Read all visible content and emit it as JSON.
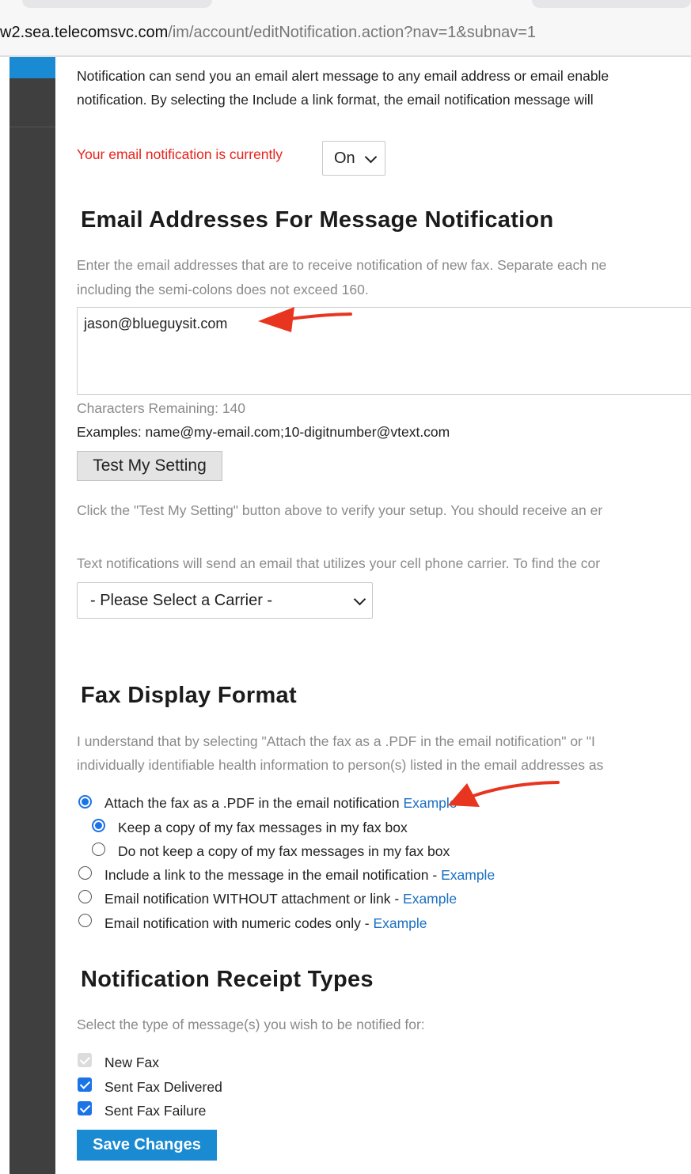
{
  "browser": {
    "url_host": "w2.sea.telecomsvc.com",
    "url_path": "/im/account/editNotification.action?nav=1&subnav=1"
  },
  "intro": {
    "line1": "Notification can send you an email alert message to any email address or email enable",
    "line2": "notification. By selecting the Include a link format, the email notification message will"
  },
  "status": {
    "label": "Your email notification is currently",
    "value": "On"
  },
  "email_section": {
    "heading": "Email Addresses For Message Notification",
    "desc1": "Enter the email addresses that are to receive notification of new fax. Separate each ne",
    "desc2": "including the semi-colons does not exceed 160.",
    "textarea_value": "jason@blueguysit.com",
    "chars_remaining": "Characters Remaining: 140",
    "examples": "Examples: name@my-email.com;10-digitnumber@vtext.com",
    "test_button": "Test My Setting",
    "test_note": "Click the \"Test My Setting\" button above to verify your setup. You should receive an er",
    "text_note": "Text notifications will send an email that utilizes your cell phone carrier. To find the cor",
    "carrier_select": "- Please Select a Carrier -"
  },
  "fax_format": {
    "heading": "Fax Display Format",
    "desc1": "I understand that by selecting \"Attach the fax as a .PDF in the email notification\" or \"I",
    "desc2": "individually identifiable health information to person(s) listed in the email addresses as",
    "options": [
      {
        "label": "Attach the fax as a .PDF in the email notification",
        "link": "Example",
        "selected": true
      },
      {
        "label": "Keep a copy of my fax messages in my fax box",
        "selected": true
      },
      {
        "label": "Do not keep a copy of my fax messages in my fax box",
        "selected": false
      },
      {
        "label": "Include a link to the message in the email notification - ",
        "link": "Example",
        "selected": false
      },
      {
        "label": "Email notification WITHOUT attachment or link - ",
        "link": "Example",
        "selected": false
      },
      {
        "label": "Email notification with numeric codes only - ",
        "link": "Example",
        "selected": false
      }
    ]
  },
  "receipt_types": {
    "heading": "Notification Receipt Types",
    "desc": "Select the type of message(s) you wish to be notified for:",
    "items": [
      {
        "label": "New Fax",
        "checked": true,
        "disabled": true
      },
      {
        "label": "Sent Fax Delivered",
        "checked": true
      },
      {
        "label": "Sent Fax Failure",
        "checked": true
      }
    ],
    "save_button": "Save Changes"
  },
  "colors": {
    "accent": "#1a8ad2",
    "sidebar": "#3f3f3f",
    "alert_text": "#e8231b",
    "annotation_arrow": "#e8351f",
    "link": "#1a6fc2"
  }
}
